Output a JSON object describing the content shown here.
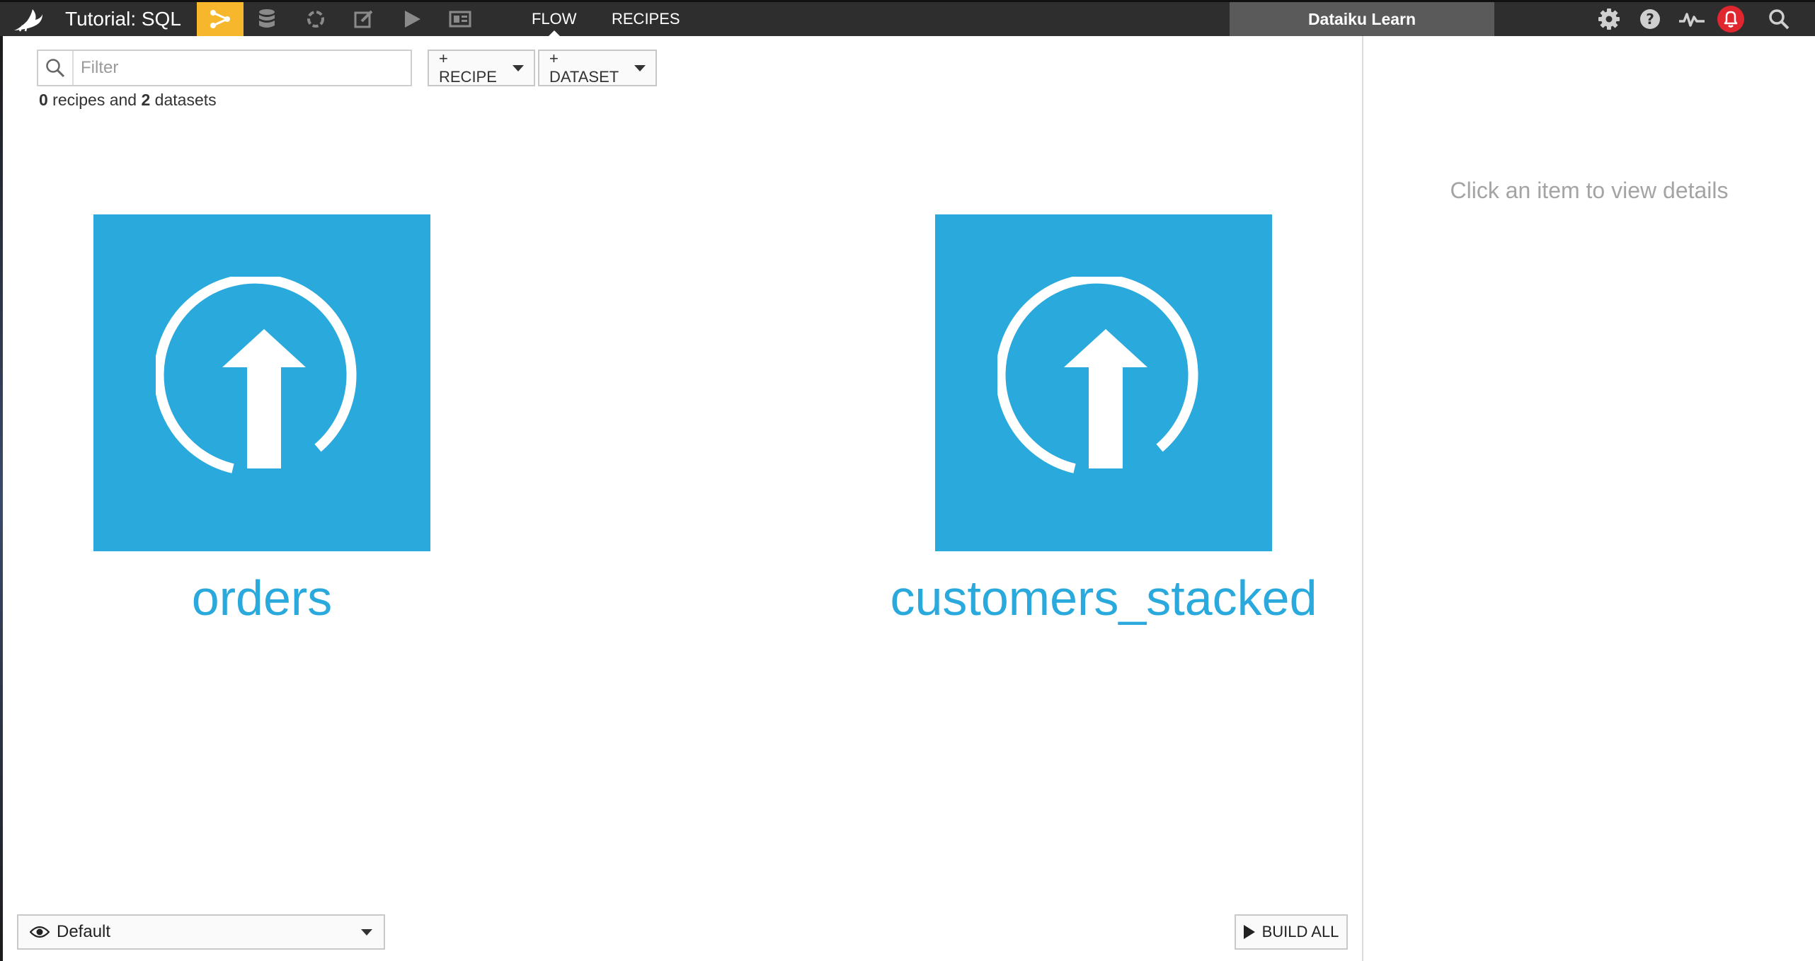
{
  "topbar": {
    "project_title": "Tutorial: SQL",
    "nav_icons": [
      "flow-icon",
      "datasets-icon",
      "recipes-icon",
      "notebooks-icon",
      "jobs-icon",
      "dashboards-icon"
    ],
    "tabs": [
      {
        "label": "FLOW",
        "active": true
      },
      {
        "label": "RECIPES",
        "active": false
      }
    ],
    "instance_name": "Dataiku Learn",
    "right_icons": [
      "settings-icon",
      "help-icon",
      "activity-icon",
      "notifications-icon",
      "search-icon"
    ],
    "active_color": "#f7b72d",
    "notification_color": "#e0262f"
  },
  "toolbar": {
    "filter_placeholder": "Filter",
    "filter_value": "",
    "recipe_button": "+ RECIPE",
    "dataset_button": "+ DATASET",
    "counts": {
      "recipes": "0",
      "recipes_text": " recipes and ",
      "datasets": "2",
      "datasets_text": " datasets"
    }
  },
  "flow": {
    "accent_color": "#29a9dc",
    "datasets": [
      {
        "name": "orders",
        "icon": "upload-icon"
      },
      {
        "name": "customers_stacked",
        "icon": "upload-icon"
      }
    ]
  },
  "footer": {
    "zone_label": "Default",
    "build_all": "BUILD ALL"
  },
  "details": {
    "hint": "Click an item to view details"
  }
}
